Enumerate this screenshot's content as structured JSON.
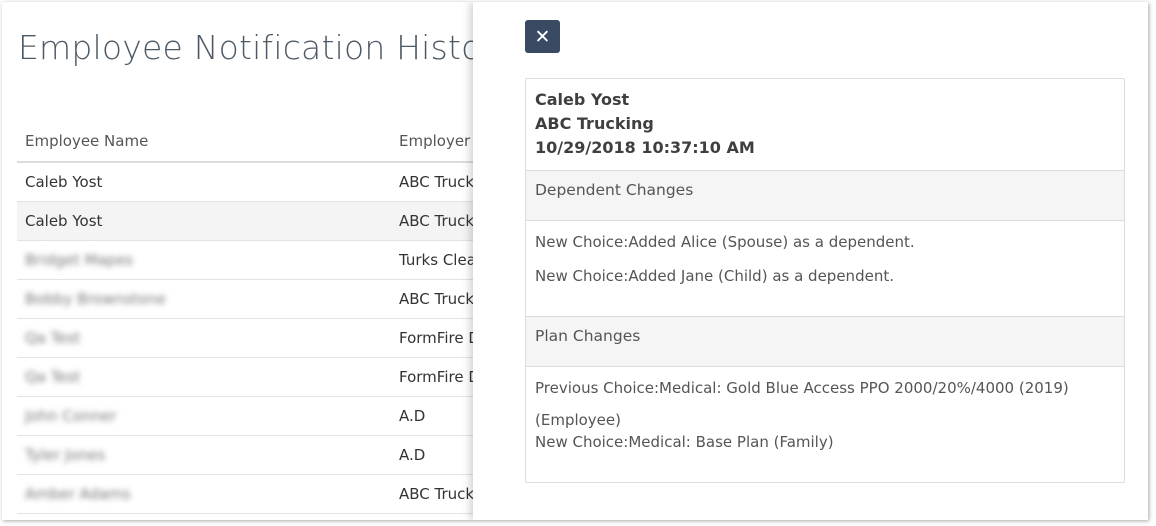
{
  "page": {
    "title": "Employee Notification History"
  },
  "table": {
    "columns": [
      "Employee Name",
      "Employer"
    ],
    "rows": [
      {
        "name": "Caleb Yost",
        "employer": "ABC Truckin",
        "blurred": false
      },
      {
        "name": "Caleb Yost",
        "employer": "ABC Truckin",
        "blurred": false
      },
      {
        "name": "Bridget Mapes",
        "employer": "Turks Clea",
        "blurred": true
      },
      {
        "name": "Bobby Brownstone",
        "employer": "ABC Truckin",
        "blurred": true
      },
      {
        "name": "Qa Test",
        "employer": "FormFire D",
        "blurred": true
      },
      {
        "name": "Qa Test",
        "employer": "FormFire D",
        "blurred": true
      },
      {
        "name": "John Conner",
        "employer": "A.D",
        "blurred": true
      },
      {
        "name": "Tyler Jones",
        "employer": "A.D",
        "blurred": true
      },
      {
        "name": "Amber Adams",
        "employer": "ABC Truckin",
        "blurred": true
      }
    ]
  },
  "panel": {
    "close_icon": "close-icon",
    "close_glyph": "✕",
    "employee": "Caleb Yost",
    "employer": "ABC Trucking",
    "timestamp": "10/29/2018 10:37:10 AM",
    "dependent_changes": {
      "title": "Dependent Changes",
      "lines": [
        "New Choice:Added Alice (Spouse) as a dependent.",
        "New Choice:Added Jane (Child) as a dependent."
      ]
    },
    "plan_changes": {
      "title": "Plan Changes",
      "previous": "Previous Choice:Medical: Gold Blue Access PPO 2000/20%/4000 (2019)",
      "previous_cont": "(Employee)",
      "new": "New Choice:Medical: Base Plan (Family)"
    }
  },
  "colors": {
    "close_button_bg": "#3a4a63",
    "section_header_bg": "#f5f5f5",
    "alt_row_bg": "#f4f4f4"
  }
}
